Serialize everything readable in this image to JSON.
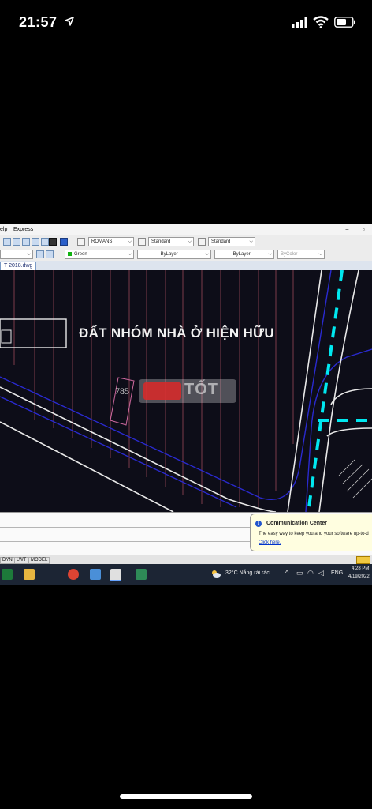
{
  "status_bar": {
    "time": "21:57"
  },
  "cad": {
    "menu": [
      "elp",
      "Express"
    ],
    "toolbar1": {
      "text_style": "ROMANS",
      "dim_style": "Standard",
      "table_style": "Standard"
    },
    "toolbar2": {
      "layer_color": "Green",
      "linetype": "ByLayer",
      "lineweight": "ByLayer",
      "plot_style": "ByColor"
    },
    "document_tab": "T 2018.dwg",
    "drawing": {
      "label": "ĐẤT NHÓM NHÀ Ở HIỆN HỮU",
      "parcel_number": "785"
    },
    "watermark": "TỐT",
    "notification": {
      "title": "Communication Center",
      "body": "The easy way to keep you and your software up-to-d",
      "link": "Click here."
    },
    "status_items": [
      "DYN",
      "LWT",
      "MODEL"
    ]
  },
  "taskbar": {
    "weather": "32°C  Nắng rải rác",
    "language": "ENG",
    "clock_time": "4:28 PM",
    "clock_date": "4/19/2022"
  }
}
